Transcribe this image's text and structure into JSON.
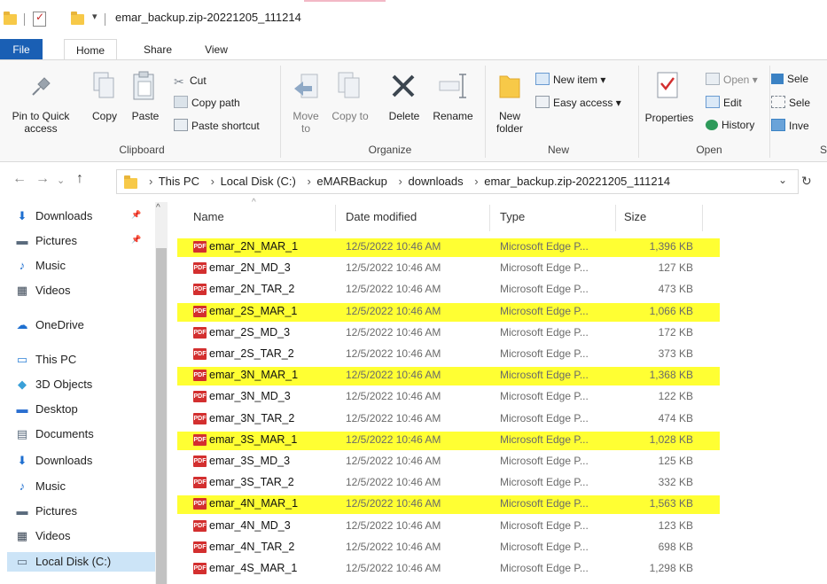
{
  "window": {
    "title": "emar_backup.zip-20221205_111214"
  },
  "tabs": {
    "file": "File",
    "home": "Home",
    "share": "Share",
    "view": "View"
  },
  "ribbon": {
    "clipboard": {
      "pin": "Pin to Quick access",
      "copy": "Copy",
      "paste": "Paste",
      "cut": "Cut",
      "copy_path": "Copy path",
      "paste_shortcut": "Paste shortcut",
      "label": "Clipboard"
    },
    "organize": {
      "move_to": "Move to",
      "copy_to": "Copy to",
      "delete": "Delete",
      "rename": "Rename",
      "label": "Organize"
    },
    "new": {
      "new_folder": "New folder",
      "new_item": "New item ▾",
      "easy_access": "Easy access ▾",
      "label": "New"
    },
    "open": {
      "properties": "Properties",
      "open": "Open ▾",
      "edit": "Edit",
      "history": "History",
      "label": "Open"
    },
    "select": {
      "select_all": "Sele",
      "select_none": "Sele",
      "invert": "Inve",
      "label": "S"
    }
  },
  "address": {
    "crumbs": [
      "This PC",
      "Local Disk (C:)",
      "eMARBackup",
      "downloads",
      "emar_backup.zip-20221205_111214"
    ]
  },
  "nav": {
    "items": [
      {
        "label": "Downloads",
        "icon": "download-arrow-icon"
      },
      {
        "label": "Pictures",
        "icon": "pictures-icon"
      },
      {
        "label": "Music",
        "icon": "music-note-icon"
      },
      {
        "label": "Videos",
        "icon": "videos-icon"
      },
      {
        "label": "OneDrive",
        "icon": "cloud-icon"
      },
      {
        "label": "This PC",
        "icon": "computer-icon"
      },
      {
        "label": "3D Objects",
        "icon": "3d-objects-icon"
      },
      {
        "label": "Desktop",
        "icon": "desktop-icon"
      },
      {
        "label": "Documents",
        "icon": "documents-icon"
      },
      {
        "label": "Downloads",
        "icon": "download-arrow-icon"
      },
      {
        "label": "Music",
        "icon": "music-note-icon"
      },
      {
        "label": "Pictures",
        "icon": "pictures-icon"
      },
      {
        "label": "Videos",
        "icon": "videos-icon"
      },
      {
        "label": "Local Disk (C:)",
        "icon": "drive-icon"
      }
    ]
  },
  "columns": {
    "name": "Name",
    "date": "Date modified",
    "type": "Type",
    "size": "Size"
  },
  "files": [
    {
      "name": "emar_2N_MAR_1",
      "date": "12/5/2022 10:46 AM",
      "type": "Microsoft Edge P...",
      "size": "1,396 KB",
      "highlighted": true
    },
    {
      "name": "emar_2N_MD_3",
      "date": "12/5/2022 10:46 AM",
      "type": "Microsoft Edge P...",
      "size": "127 KB",
      "highlighted": false
    },
    {
      "name": "emar_2N_TAR_2",
      "date": "12/5/2022 10:46 AM",
      "type": "Microsoft Edge P...",
      "size": "473 KB",
      "highlighted": false
    },
    {
      "name": "emar_2S_MAR_1",
      "date": "12/5/2022 10:46 AM",
      "type": "Microsoft Edge P...",
      "size": "1,066 KB",
      "highlighted": true
    },
    {
      "name": "emar_2S_MD_3",
      "date": "12/5/2022 10:46 AM",
      "type": "Microsoft Edge P...",
      "size": "172 KB",
      "highlighted": false
    },
    {
      "name": "emar_2S_TAR_2",
      "date": "12/5/2022 10:46 AM",
      "type": "Microsoft Edge P...",
      "size": "373 KB",
      "highlighted": false
    },
    {
      "name": "emar_3N_MAR_1",
      "date": "12/5/2022 10:46 AM",
      "type": "Microsoft Edge P...",
      "size": "1,368 KB",
      "highlighted": true
    },
    {
      "name": "emar_3N_MD_3",
      "date": "12/5/2022 10:46 AM",
      "type": "Microsoft Edge P...",
      "size": "122 KB",
      "highlighted": false
    },
    {
      "name": "emar_3N_TAR_2",
      "date": "12/5/2022 10:46 AM",
      "type": "Microsoft Edge P...",
      "size": "474 KB",
      "highlighted": false
    },
    {
      "name": "emar_3S_MAR_1",
      "date": "12/5/2022 10:46 AM",
      "type": "Microsoft Edge P...",
      "size": "1,028 KB",
      "highlighted": true
    },
    {
      "name": "emar_3S_MD_3",
      "date": "12/5/2022 10:46 AM",
      "type": "Microsoft Edge P...",
      "size": "125 KB",
      "highlighted": false
    },
    {
      "name": "emar_3S_TAR_2",
      "date": "12/5/2022 10:46 AM",
      "type": "Microsoft Edge P...",
      "size": "332 KB",
      "highlighted": false
    },
    {
      "name": "emar_4N_MAR_1",
      "date": "12/5/2022 10:46 AM",
      "type": "Microsoft Edge P...",
      "size": "1,563 KB",
      "highlighted": true
    },
    {
      "name": "emar_4N_MD_3",
      "date": "12/5/2022 10:46 AM",
      "type": "Microsoft Edge P...",
      "size": "123 KB",
      "highlighted": false
    },
    {
      "name": "emar_4N_TAR_2",
      "date": "12/5/2022 10:46 AM",
      "type": "Microsoft Edge P...",
      "size": "698 KB",
      "highlighted": false
    },
    {
      "name": "emar_4S_MAR_1",
      "date": "12/5/2022 10:46 AM",
      "type": "Microsoft Edge P...",
      "size": "1,298 KB",
      "highlighted": false
    }
  ],
  "colors": {
    "highlight": "#ffff33",
    "file_tab": "#1a5fb4",
    "selected_nav": "#cce4f7"
  }
}
